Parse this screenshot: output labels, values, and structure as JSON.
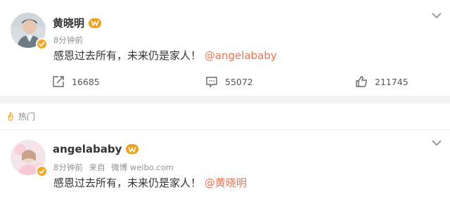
{
  "posts": [
    {
      "username": "黄晓明",
      "time": "8分钟前",
      "source": "",
      "text_main": "感恩过去所有，未来仍是家人！",
      "mention": "@angelababy",
      "actions": {
        "repost": "16685",
        "comment": "55072",
        "like": "211745"
      }
    },
    {
      "username": "angelababy",
      "time": "8分钟前",
      "source_prefix": "来自",
      "source": "微博 weibo.com",
      "text_main": "感恩过去所有，未来仍是家人！",
      "mention": "@黄晓明"
    }
  ],
  "section_label": "热门",
  "colors": {
    "mention": "#eb7350",
    "meta": "#939393",
    "verify": "#f6a623"
  },
  "icons": [
    "share-icon",
    "comment-icon",
    "like-icon",
    "chevron-down-icon",
    "flame-icon",
    "verified-badge-icon",
    "vip-badge-icon"
  ]
}
